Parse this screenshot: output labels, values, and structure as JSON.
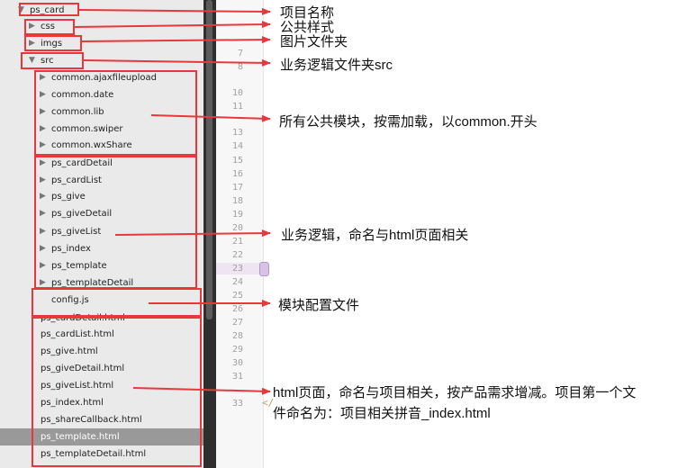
{
  "tree": {
    "root": {
      "label": "ps_card",
      "icon": "triangle-down-icon"
    },
    "folders": [
      {
        "label": "css",
        "icon": "triangle-right-icon"
      },
      {
        "label": "imgs",
        "icon": "triangle-right-icon"
      },
      {
        "label": "src",
        "icon": "triangle-down-icon"
      }
    ],
    "common_modules": [
      "common.ajaxfileupload",
      "common.date",
      "common.lib",
      "common.swiper",
      "common.wxShare"
    ],
    "business_modules": [
      "ps_cardDetail",
      "ps_cardList",
      "ps_give",
      "ps_giveDetail",
      "ps_giveList",
      "ps_index",
      "ps_template",
      "ps_templateDetail"
    ],
    "config_file": "config.js",
    "html_files": [
      "ps_cardDetail.html",
      "ps_cardList.html",
      "ps_give.html",
      "ps_giveDetail.html",
      "ps_giveList.html",
      "ps_index.html",
      "ps_shareCallback.html",
      "ps_template.html",
      "ps_templateDetail.html"
    ],
    "selected_file": "ps_template.html"
  },
  "editor": {
    "line_numbers": [
      "7",
      "8",
      "10",
      "11",
      "13",
      "14",
      "15",
      "16",
      "17",
      "18",
      "19",
      "20",
      "21",
      "22",
      "23",
      "24",
      "25",
      "26",
      "27",
      "28",
      "29",
      "30",
      "31",
      "33"
    ],
    "current_line": "23",
    "code_snippet": "</"
  },
  "annotations": {
    "project_name": "项目名称",
    "public_styles": "公共样式",
    "image_folder": "图片文件夹",
    "business_src": "业务逻辑文件夹src",
    "common_modules": "所有公共模块，按需加载，以common.开头",
    "business_logic": "业务逻辑，命名与html页面相关",
    "config_file": "模块配置文件",
    "html_pages_line1": "html页面，命名与项目相关，按产品需求增减。项目第一个文",
    "html_pages_line2": "件命名为：项目相关拼音_index.html"
  },
  "colors": {
    "annotation_red": "#e8383d",
    "tree_bg": "#eaeaea",
    "selected_row": "#999999",
    "current_line_marker": "#d7c2e8"
  }
}
